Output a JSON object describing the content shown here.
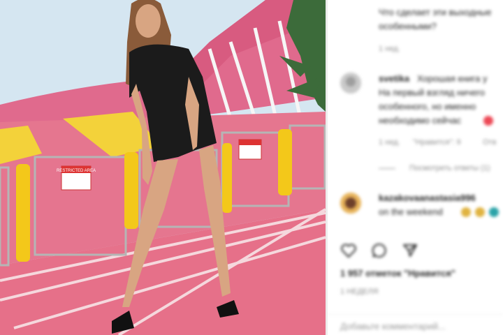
{
  "post": {
    "sign_text": "RESTRICTED AREA",
    "sign_text_2": "RESTRICTED AREA"
  },
  "comments": [
    {
      "text_line1": "Что сделает эти выходные",
      "text_line2": "особенными?",
      "time": "1 нед."
    },
    {
      "username": "svetika",
      "text_line1": "Хорошая книга у",
      "text_line2": "На первый взгляд ничего",
      "text_line3": "особенного, но именно",
      "text_line4": "необходимо сейчас",
      "time": "1 нед.",
      "likes": "\"Нравится\": 9",
      "reply": "Отв",
      "view_replies": "Посмотреть ответы (1)"
    },
    {
      "username": "kazakovaanastasia996",
      "text_line1": "on the weekend"
    }
  ],
  "actions": {
    "like_icon": "heart-icon",
    "comment_icon": "comment-icon",
    "share_icon": "send-icon"
  },
  "likes_count": "1 957 отметок \"Нравится\"",
  "post_time": "1 НЕДЕЛЯ",
  "add_comment_placeholder": "Добавьте комментарий...",
  "colors": {
    "pink": "#e96a86",
    "yellow": "#f3d23a",
    "sky": "#cfe3ef",
    "heart": "#ed4956"
  }
}
